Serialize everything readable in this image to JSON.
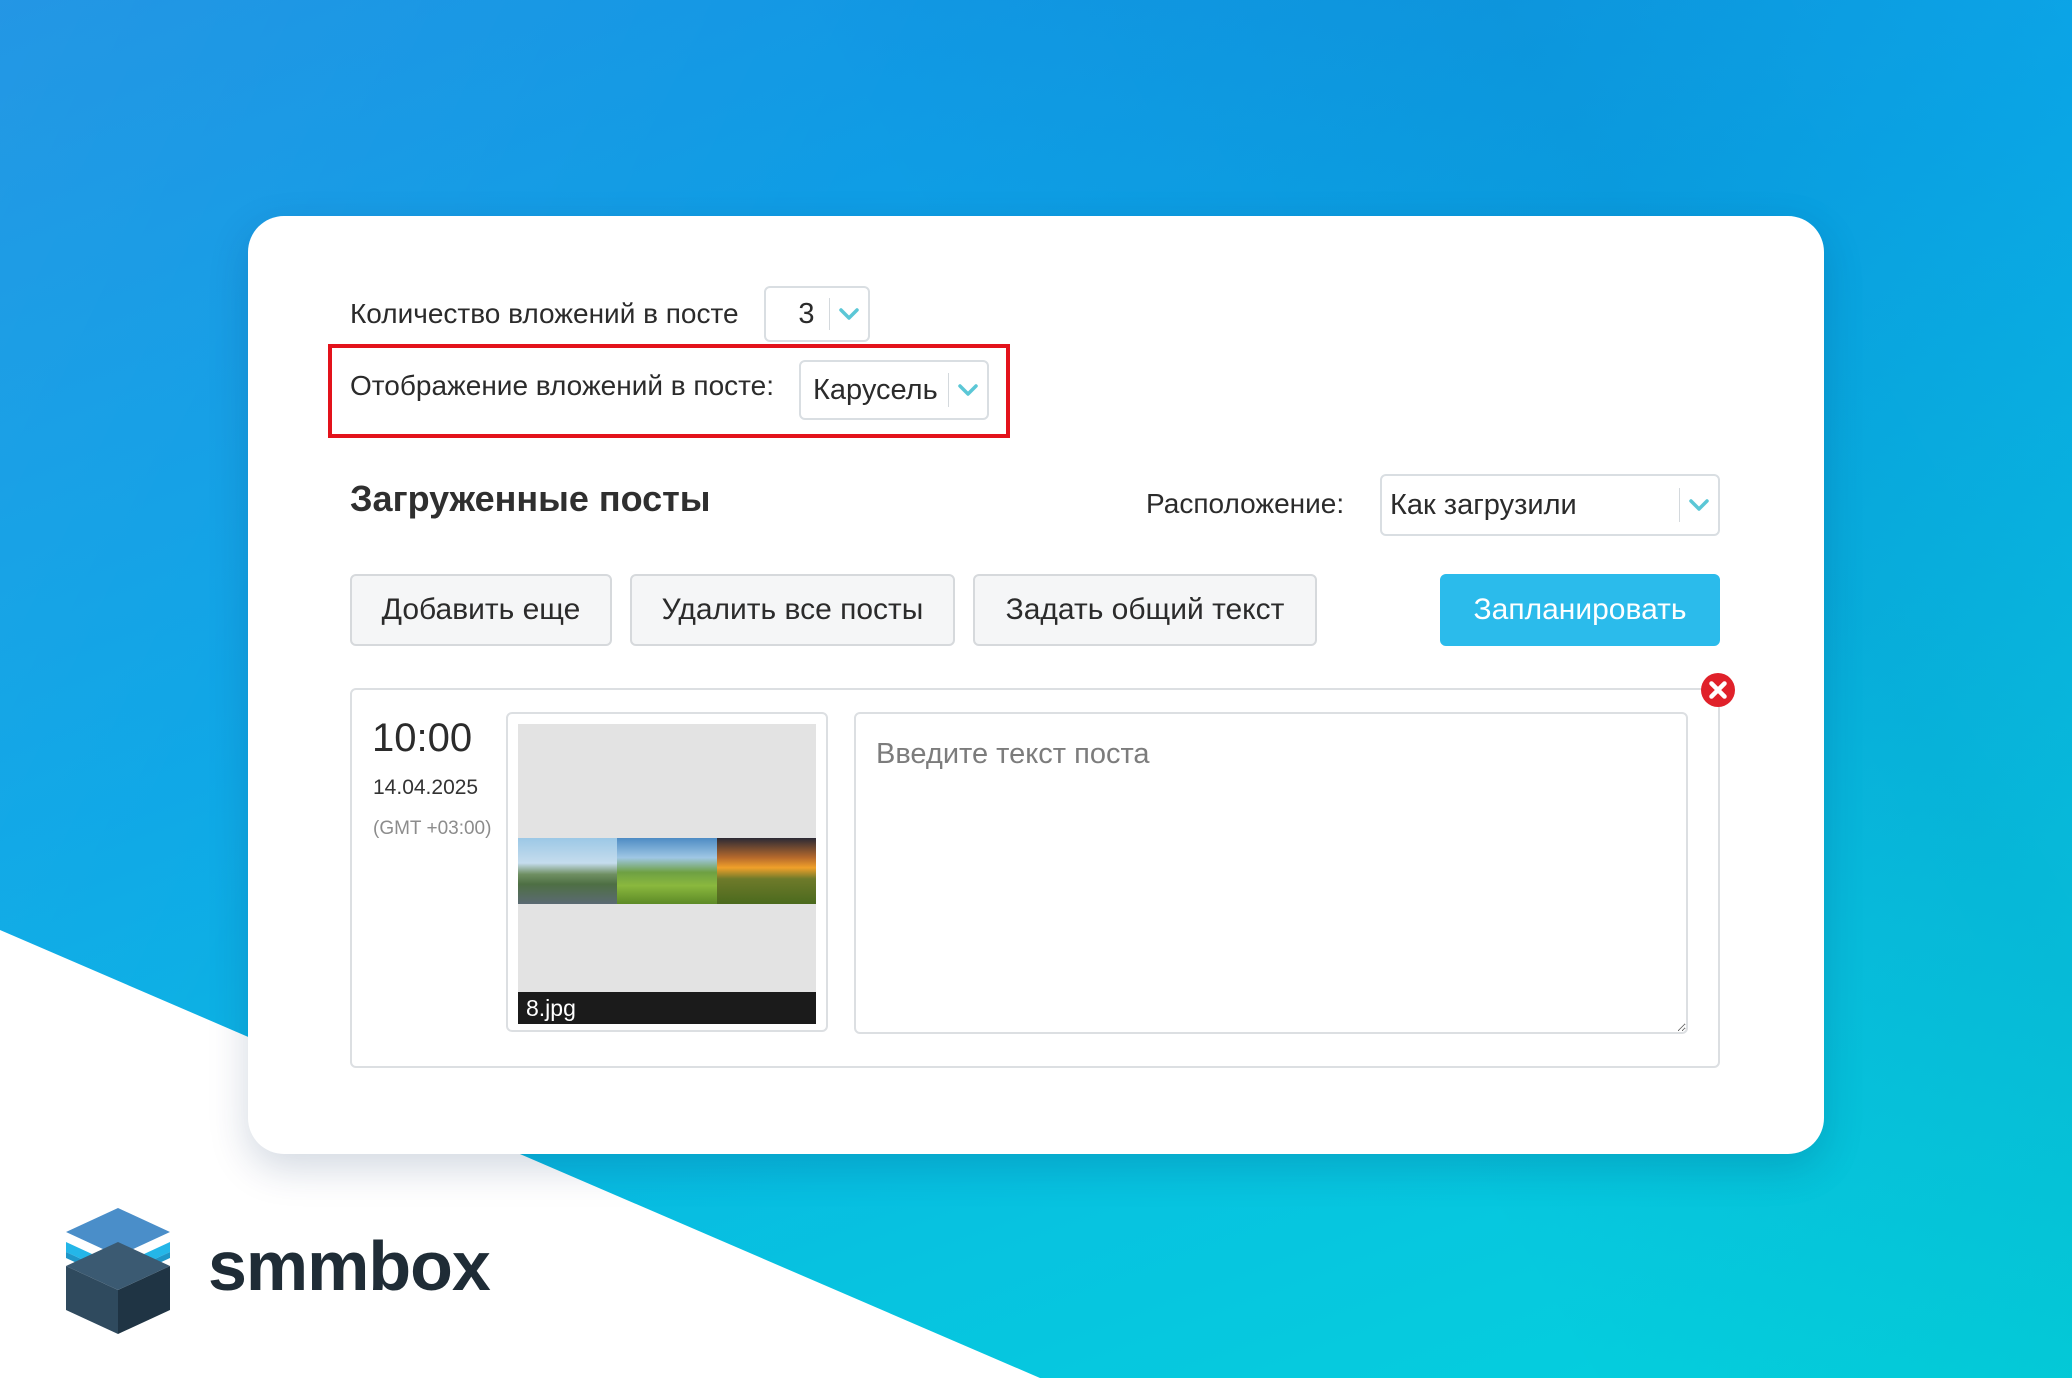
{
  "settings": {
    "attachments_count_label": "Количество вложений в посте",
    "attachments_count_value": "3",
    "attachments_display_label": "Отображение вложений в посте:",
    "attachments_display_value": "Карусель"
  },
  "posts_section": {
    "title": "Загруженные посты",
    "order_label": "Расположение:",
    "order_value": "Как загрузили"
  },
  "toolbar": {
    "add_more": "Добавить еще",
    "delete_all": "Удалить все посты",
    "set_common_text": "Задать общий текст",
    "schedule": "Запланировать"
  },
  "post": {
    "time": "10:00",
    "date": "14.04.2025",
    "timezone": "(GMT +03:00)",
    "file_name": "8.jpg",
    "text_placeholder": "Введите текст поста"
  },
  "brand": {
    "name": "smmbox"
  },
  "colors": {
    "accent": "#2bbbeb",
    "highlight": "#e3121b",
    "close": "#e0212a",
    "chevron": "#5bc7d6"
  },
  "icons": {
    "dropdown": "chevron-down-icon",
    "remove_post": "close-icon",
    "logo": "stacked-box-logo"
  }
}
